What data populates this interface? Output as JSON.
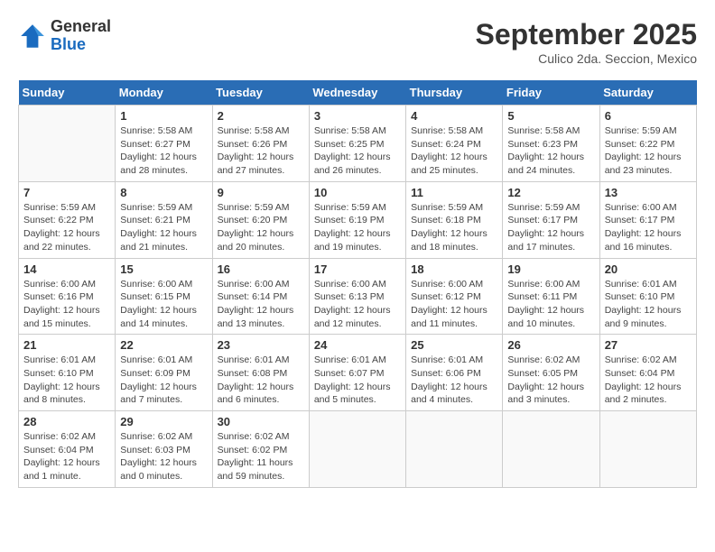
{
  "logo": {
    "general": "General",
    "blue": "Blue"
  },
  "title": "September 2025",
  "subtitle": "Culico 2da. Seccion, Mexico",
  "days_of_week": [
    "Sunday",
    "Monday",
    "Tuesday",
    "Wednesday",
    "Thursday",
    "Friday",
    "Saturday"
  ],
  "weeks": [
    [
      {
        "num": "",
        "info": ""
      },
      {
        "num": "1",
        "info": "Sunrise: 5:58 AM\nSunset: 6:27 PM\nDaylight: 12 hours\nand 28 minutes."
      },
      {
        "num": "2",
        "info": "Sunrise: 5:58 AM\nSunset: 6:26 PM\nDaylight: 12 hours\nand 27 minutes."
      },
      {
        "num": "3",
        "info": "Sunrise: 5:58 AM\nSunset: 6:25 PM\nDaylight: 12 hours\nand 26 minutes."
      },
      {
        "num": "4",
        "info": "Sunrise: 5:58 AM\nSunset: 6:24 PM\nDaylight: 12 hours\nand 25 minutes."
      },
      {
        "num": "5",
        "info": "Sunrise: 5:58 AM\nSunset: 6:23 PM\nDaylight: 12 hours\nand 24 minutes."
      },
      {
        "num": "6",
        "info": "Sunrise: 5:59 AM\nSunset: 6:22 PM\nDaylight: 12 hours\nand 23 minutes."
      }
    ],
    [
      {
        "num": "7",
        "info": "Sunrise: 5:59 AM\nSunset: 6:22 PM\nDaylight: 12 hours\nand 22 minutes."
      },
      {
        "num": "8",
        "info": "Sunrise: 5:59 AM\nSunset: 6:21 PM\nDaylight: 12 hours\nand 21 minutes."
      },
      {
        "num": "9",
        "info": "Sunrise: 5:59 AM\nSunset: 6:20 PM\nDaylight: 12 hours\nand 20 minutes."
      },
      {
        "num": "10",
        "info": "Sunrise: 5:59 AM\nSunset: 6:19 PM\nDaylight: 12 hours\nand 19 minutes."
      },
      {
        "num": "11",
        "info": "Sunrise: 5:59 AM\nSunset: 6:18 PM\nDaylight: 12 hours\nand 18 minutes."
      },
      {
        "num": "12",
        "info": "Sunrise: 5:59 AM\nSunset: 6:17 PM\nDaylight: 12 hours\nand 17 minutes."
      },
      {
        "num": "13",
        "info": "Sunrise: 6:00 AM\nSunset: 6:17 PM\nDaylight: 12 hours\nand 16 minutes."
      }
    ],
    [
      {
        "num": "14",
        "info": "Sunrise: 6:00 AM\nSunset: 6:16 PM\nDaylight: 12 hours\nand 15 minutes."
      },
      {
        "num": "15",
        "info": "Sunrise: 6:00 AM\nSunset: 6:15 PM\nDaylight: 12 hours\nand 14 minutes."
      },
      {
        "num": "16",
        "info": "Sunrise: 6:00 AM\nSunset: 6:14 PM\nDaylight: 12 hours\nand 13 minutes."
      },
      {
        "num": "17",
        "info": "Sunrise: 6:00 AM\nSunset: 6:13 PM\nDaylight: 12 hours\nand 12 minutes."
      },
      {
        "num": "18",
        "info": "Sunrise: 6:00 AM\nSunset: 6:12 PM\nDaylight: 12 hours\nand 11 minutes."
      },
      {
        "num": "19",
        "info": "Sunrise: 6:00 AM\nSunset: 6:11 PM\nDaylight: 12 hours\nand 10 minutes."
      },
      {
        "num": "20",
        "info": "Sunrise: 6:01 AM\nSunset: 6:10 PM\nDaylight: 12 hours\nand 9 minutes."
      }
    ],
    [
      {
        "num": "21",
        "info": "Sunrise: 6:01 AM\nSunset: 6:10 PM\nDaylight: 12 hours\nand 8 minutes."
      },
      {
        "num": "22",
        "info": "Sunrise: 6:01 AM\nSunset: 6:09 PM\nDaylight: 12 hours\nand 7 minutes."
      },
      {
        "num": "23",
        "info": "Sunrise: 6:01 AM\nSunset: 6:08 PM\nDaylight: 12 hours\nand 6 minutes."
      },
      {
        "num": "24",
        "info": "Sunrise: 6:01 AM\nSunset: 6:07 PM\nDaylight: 12 hours\nand 5 minutes."
      },
      {
        "num": "25",
        "info": "Sunrise: 6:01 AM\nSunset: 6:06 PM\nDaylight: 12 hours\nand 4 minutes."
      },
      {
        "num": "26",
        "info": "Sunrise: 6:02 AM\nSunset: 6:05 PM\nDaylight: 12 hours\nand 3 minutes."
      },
      {
        "num": "27",
        "info": "Sunrise: 6:02 AM\nSunset: 6:04 PM\nDaylight: 12 hours\nand 2 minutes."
      }
    ],
    [
      {
        "num": "28",
        "info": "Sunrise: 6:02 AM\nSunset: 6:04 PM\nDaylight: 12 hours\nand 1 minute."
      },
      {
        "num": "29",
        "info": "Sunrise: 6:02 AM\nSunset: 6:03 PM\nDaylight: 12 hours\nand 0 minutes."
      },
      {
        "num": "30",
        "info": "Sunrise: 6:02 AM\nSunset: 6:02 PM\nDaylight: 11 hours\nand 59 minutes."
      },
      {
        "num": "",
        "info": ""
      },
      {
        "num": "",
        "info": ""
      },
      {
        "num": "",
        "info": ""
      },
      {
        "num": "",
        "info": ""
      }
    ]
  ]
}
